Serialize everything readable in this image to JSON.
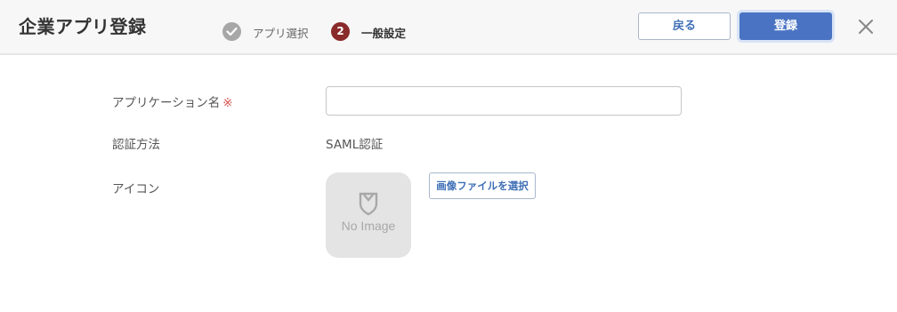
{
  "header": {
    "title": "企業アプリ登録",
    "steps": [
      {
        "label": "アプリ選択",
        "state": "done",
        "icon": "check-icon"
      },
      {
        "number": "2",
        "label": "一般設定",
        "state": "current"
      }
    ],
    "back_label": "戻る",
    "register_label": "登録",
    "close_icon": "close-icon"
  },
  "form": {
    "app_name": {
      "label": "アプリケーション名",
      "required_mark": "※",
      "value": ""
    },
    "auth_method": {
      "label": "認証方法",
      "value": "SAML認証"
    },
    "icon": {
      "label": "アイコン",
      "placeholder_text": "No Image",
      "choose_label": "画像ファイルを選択"
    }
  },
  "colors": {
    "primary": "#4a74c3",
    "step_current": "#8a2a2a",
    "step_done": "#a7a7a7",
    "required": "#d9534f"
  }
}
